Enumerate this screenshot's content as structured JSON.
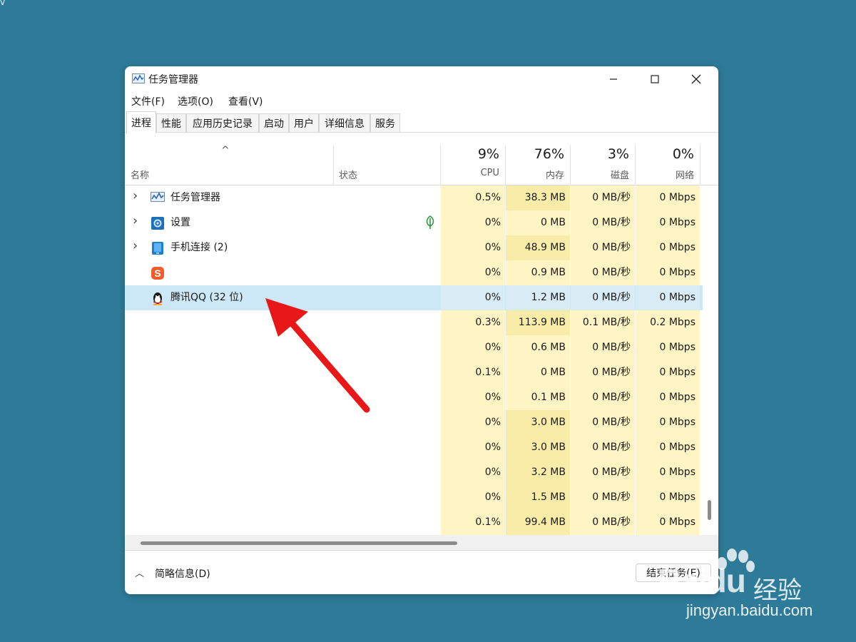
{
  "background": "#2d7b98",
  "corner_glyph": "v",
  "window": {
    "title": "任务管理器",
    "menu": [
      "文件(F)",
      "选项(O)",
      "查看(V)"
    ],
    "tabs": [
      {
        "label": "进程",
        "active": true
      },
      {
        "label": "性能",
        "active": false
      },
      {
        "label": "应用历史记录",
        "active": false
      },
      {
        "label": "启动",
        "active": false
      },
      {
        "label": "用户",
        "active": false
      },
      {
        "label": "详细信息",
        "active": false
      },
      {
        "label": "服务",
        "active": false
      }
    ],
    "columns": {
      "name": "名称",
      "status": "状态",
      "cpu": {
        "pct": "9%",
        "label": "CPU"
      },
      "memory": {
        "pct": "76%",
        "label": "内存"
      },
      "disk": {
        "pct": "3%",
        "label": "磁盘"
      },
      "network": {
        "pct": "0%",
        "label": "网络"
      }
    },
    "rows": [
      {
        "expand": true,
        "icon": "task-manager-icon",
        "name": "任务管理器",
        "leaf": false,
        "cpu": "0.5%",
        "mem": "38.3 MB",
        "disk": "0 MB/秒",
        "net": "0 Mbps"
      },
      {
        "expand": true,
        "icon": "settings-gear-icon",
        "name": "设置",
        "leaf": true,
        "cpu": "0%",
        "mem": "0 MB",
        "disk": "0 MB/秒",
        "net": "0 Mbps"
      },
      {
        "expand": true,
        "icon": "phone-link-icon",
        "name": "手机连接 (2)",
        "leaf": false,
        "cpu": "0%",
        "mem": "48.9 MB",
        "disk": "0 MB/秒",
        "net": "0 Mbps"
      },
      {
        "expand": false,
        "icon": "sogou-s-icon",
        "name": "",
        "leaf": false,
        "cpu": "0%",
        "mem": "0.9 MB",
        "disk": "0 MB/秒",
        "net": "0 Mbps"
      },
      {
        "expand": false,
        "icon": "qq-penguin-icon",
        "name": "腾讯QQ (32 位)",
        "leaf": false,
        "selected": true,
        "cpu": "0%",
        "mem": "1.2 MB",
        "disk": "0 MB/秒",
        "net": "0 Mbps"
      },
      {
        "expand": false,
        "icon": "",
        "name": "",
        "leaf": false,
        "cpu": "0.3%",
        "mem": "113.9 MB",
        "disk": "0.1 MB/秒",
        "net": "0.2 Mbps"
      },
      {
        "expand": false,
        "icon": "",
        "name": "",
        "leaf": false,
        "cpu": "0%",
        "mem": "0.6 MB",
        "disk": "0 MB/秒",
        "net": "0 Mbps"
      },
      {
        "expand": false,
        "icon": "",
        "name": "",
        "leaf": false,
        "cpu": "0.1%",
        "mem": "0 MB",
        "disk": "0 MB/秒",
        "net": "0 Mbps"
      },
      {
        "expand": false,
        "icon": "",
        "name": "",
        "leaf": false,
        "cpu": "0%",
        "mem": "0.1 MB",
        "disk": "0 MB/秒",
        "net": "0 Mbps"
      },
      {
        "expand": false,
        "icon": "",
        "name": "",
        "leaf": false,
        "cpu": "0%",
        "mem": "3.0 MB",
        "disk": "0 MB/秒",
        "net": "0 Mbps"
      },
      {
        "expand": false,
        "icon": "",
        "name": "",
        "leaf": false,
        "cpu": "0%",
        "mem": "3.0 MB",
        "disk": "0 MB/秒",
        "net": "0 Mbps"
      },
      {
        "expand": false,
        "icon": "",
        "name": "",
        "leaf": false,
        "cpu": "0%",
        "mem": "3.2 MB",
        "disk": "0 MB/秒",
        "net": "0 Mbps"
      },
      {
        "expand": false,
        "icon": "",
        "name": "",
        "leaf": false,
        "cpu": "0%",
        "mem": "1.5 MB",
        "disk": "0 MB/秒",
        "net": "0 Mbps"
      },
      {
        "expand": false,
        "icon": "",
        "name": "",
        "leaf": false,
        "cpu": "0.1%",
        "mem": "99.4 MB",
        "disk": "0 MB/秒",
        "net": "0 Mbps"
      }
    ],
    "footer": {
      "fewer_details": "简略信息(D)",
      "end_task": "结束任务(E)"
    }
  },
  "colors": {
    "heat_light": "#fff4c4",
    "heat_medium": "#f9eca8",
    "selected_row": "#cce8f6",
    "annotation_arrow": "#e81818"
  },
  "watermark": {
    "brand": "Bai",
    "brand2": "du",
    "name": "经验",
    "url": "jingyan.baidu.com"
  }
}
